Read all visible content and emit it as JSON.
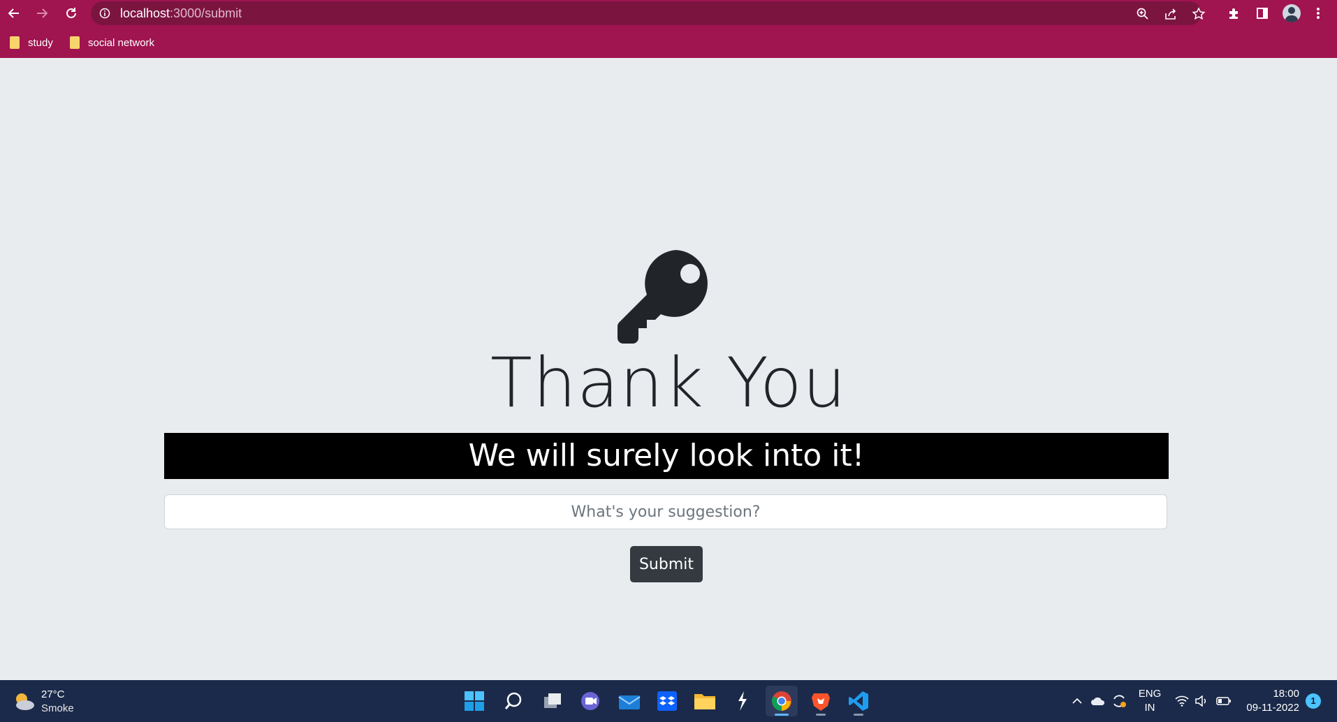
{
  "browser": {
    "url_host": "localhost",
    "url_path": ":3000/submit",
    "bookmarks": [
      {
        "label": "study"
      },
      {
        "label": "social network"
      }
    ]
  },
  "page": {
    "title": "Thank You",
    "banner": "We will surely look into it!",
    "suggestion_placeholder": "What's your suggestion?",
    "submit_label": "Submit"
  },
  "taskbar": {
    "weather_temp": "27°C",
    "weather_desc": "Smoke",
    "lang_line1": "ENG",
    "lang_line2": "IN",
    "time": "18:00",
    "date": "09-11-2022",
    "notification_count": "1"
  },
  "colors": {
    "chrome": "#a01450",
    "page_bg": "#e9ecef",
    "taskbar": "#1b2a4a"
  }
}
